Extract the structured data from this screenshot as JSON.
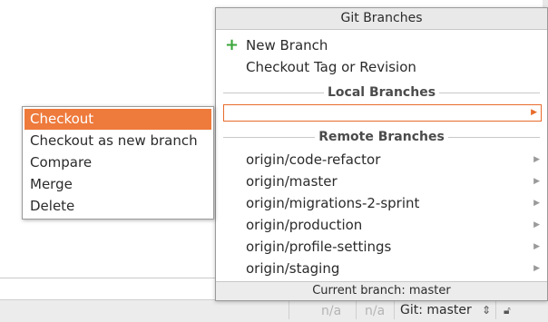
{
  "popup": {
    "title": "Git Branches",
    "new_branch": "New Branch",
    "checkout_tag": "Checkout Tag or Revision",
    "local_section": "Local Branches",
    "remote_section": "Remote Branches",
    "remote_branches": [
      "origin/code-refactor",
      "origin/master",
      "origin/migrations-2-sprint",
      "origin/production",
      "origin/profile-settings",
      "origin/staging"
    ],
    "footer": "Current branch: master"
  },
  "submenu": {
    "items": [
      "Checkout",
      "Checkout as new branch",
      "Compare",
      "Merge",
      "Delete"
    ],
    "selected": "Checkout"
  },
  "statusbar": {
    "na1": "n/a",
    "na2": "n/a",
    "branch": "Git: master"
  },
  "colors": {
    "accent": "#ee7a3c",
    "plus": "#3aa53a"
  },
  "icons": {
    "plus": "plus-icon",
    "arrow": "submenu-arrow-icon",
    "lock": "lock-icon",
    "updown": "updown-icon"
  }
}
